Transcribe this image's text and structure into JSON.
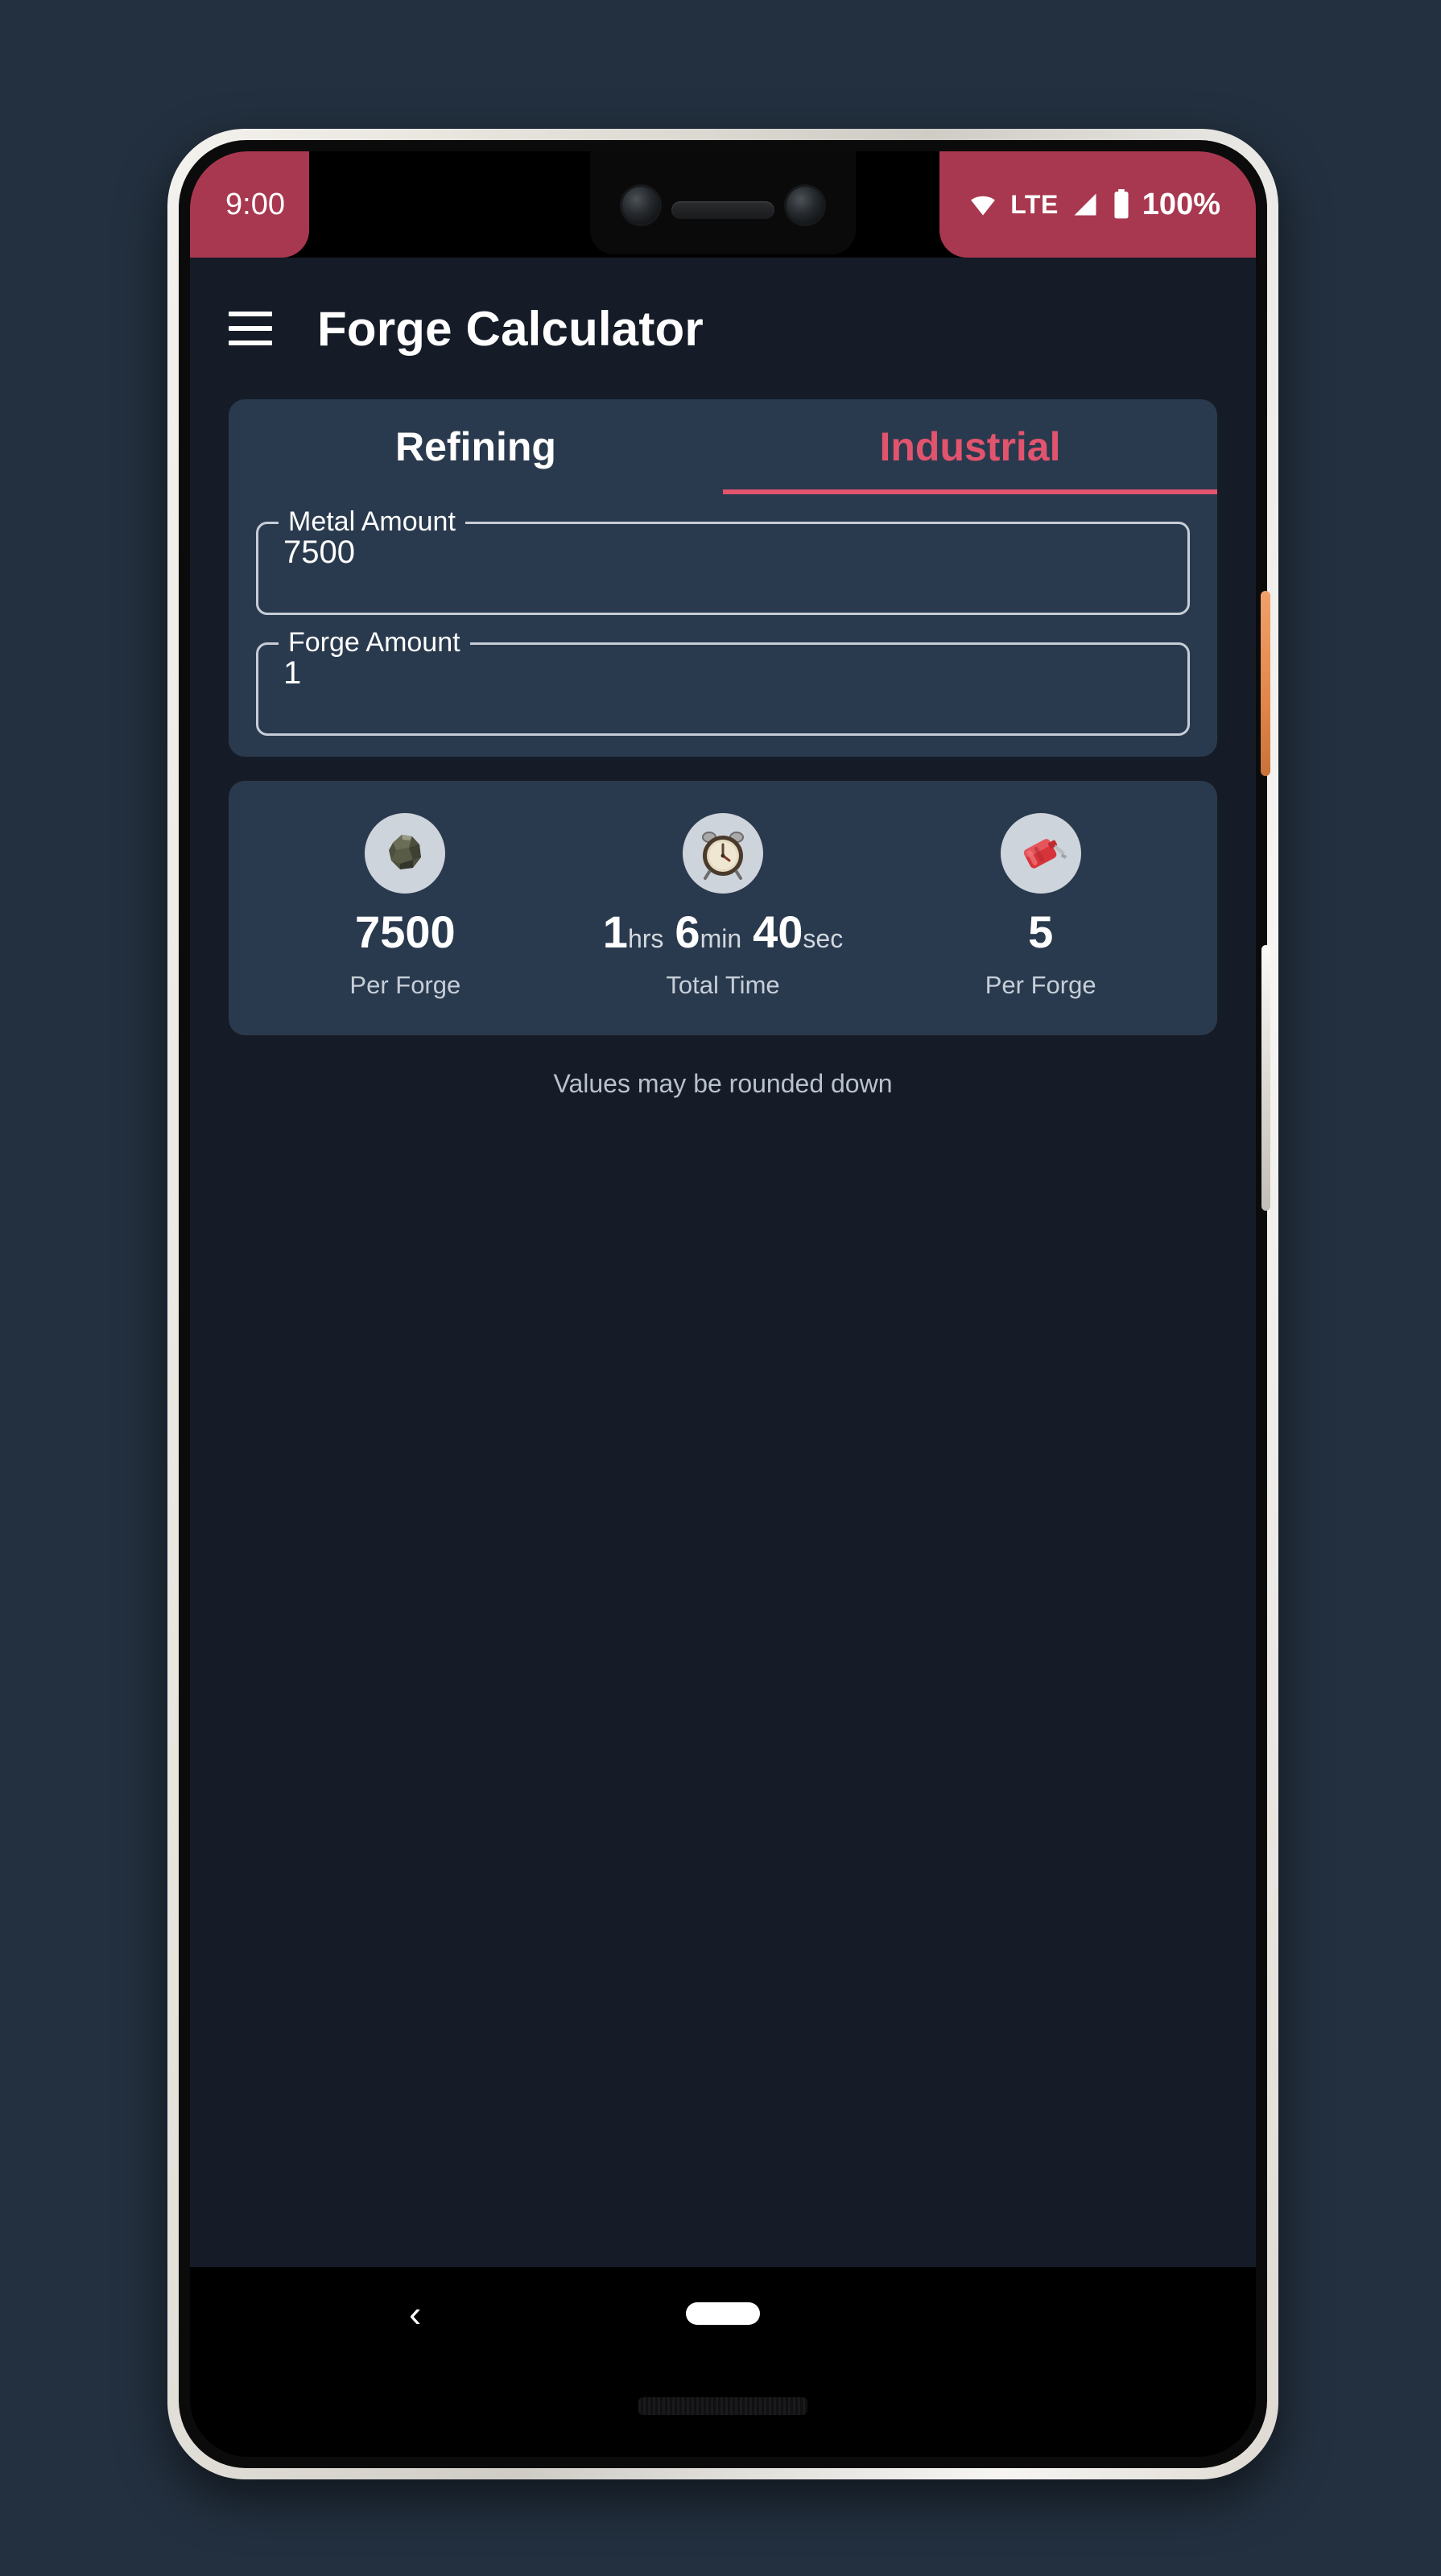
{
  "theme": {
    "page_background": "#23303f",
    "app_background": "#151c27",
    "card_background": "#2a3a4e",
    "status_bar_color": "#a8384f",
    "accent_color": "#e2546e",
    "text_primary": "#ffffff",
    "text_secondary": "#c6ced8",
    "icon_circle": "#ced4db"
  },
  "status_bar": {
    "time": "9:00",
    "wifi_icon": "wifi-icon",
    "network_label": "LTE",
    "signal_icon": "cellular-signal-icon",
    "battery_icon": "battery-full-icon",
    "battery_percent": "100%"
  },
  "app_bar": {
    "menu_icon": "hamburger-menu-icon",
    "title": "Forge Calculator"
  },
  "tabs": [
    {
      "label": "Refining",
      "active": false
    },
    {
      "label": "Industrial",
      "active": true
    }
  ],
  "inputs": [
    {
      "label": "Metal Amount",
      "value": "7500",
      "placeholder": "Metal Amount"
    },
    {
      "label": "Forge Amount",
      "value": "1",
      "placeholder": "Forge Amount"
    }
  ],
  "results": [
    {
      "icon": "metal-ore-icon",
      "value": "7500",
      "label": "Per Forge"
    },
    {
      "icon": "alarm-clock-icon",
      "label": "Total Time",
      "time": {
        "hours": "1",
        "hours_unit": "hrs",
        "minutes": "6",
        "minutes_unit": "min",
        "seconds": "40",
        "seconds_unit": "sec"
      }
    },
    {
      "icon": "fuel-can-icon",
      "value": "5",
      "label": "Per Forge"
    }
  ],
  "footnote": "Values may be rounded down",
  "nav_bar": {
    "back_icon": "back-chevron-icon",
    "home_icon": "home-pill-icon"
  }
}
